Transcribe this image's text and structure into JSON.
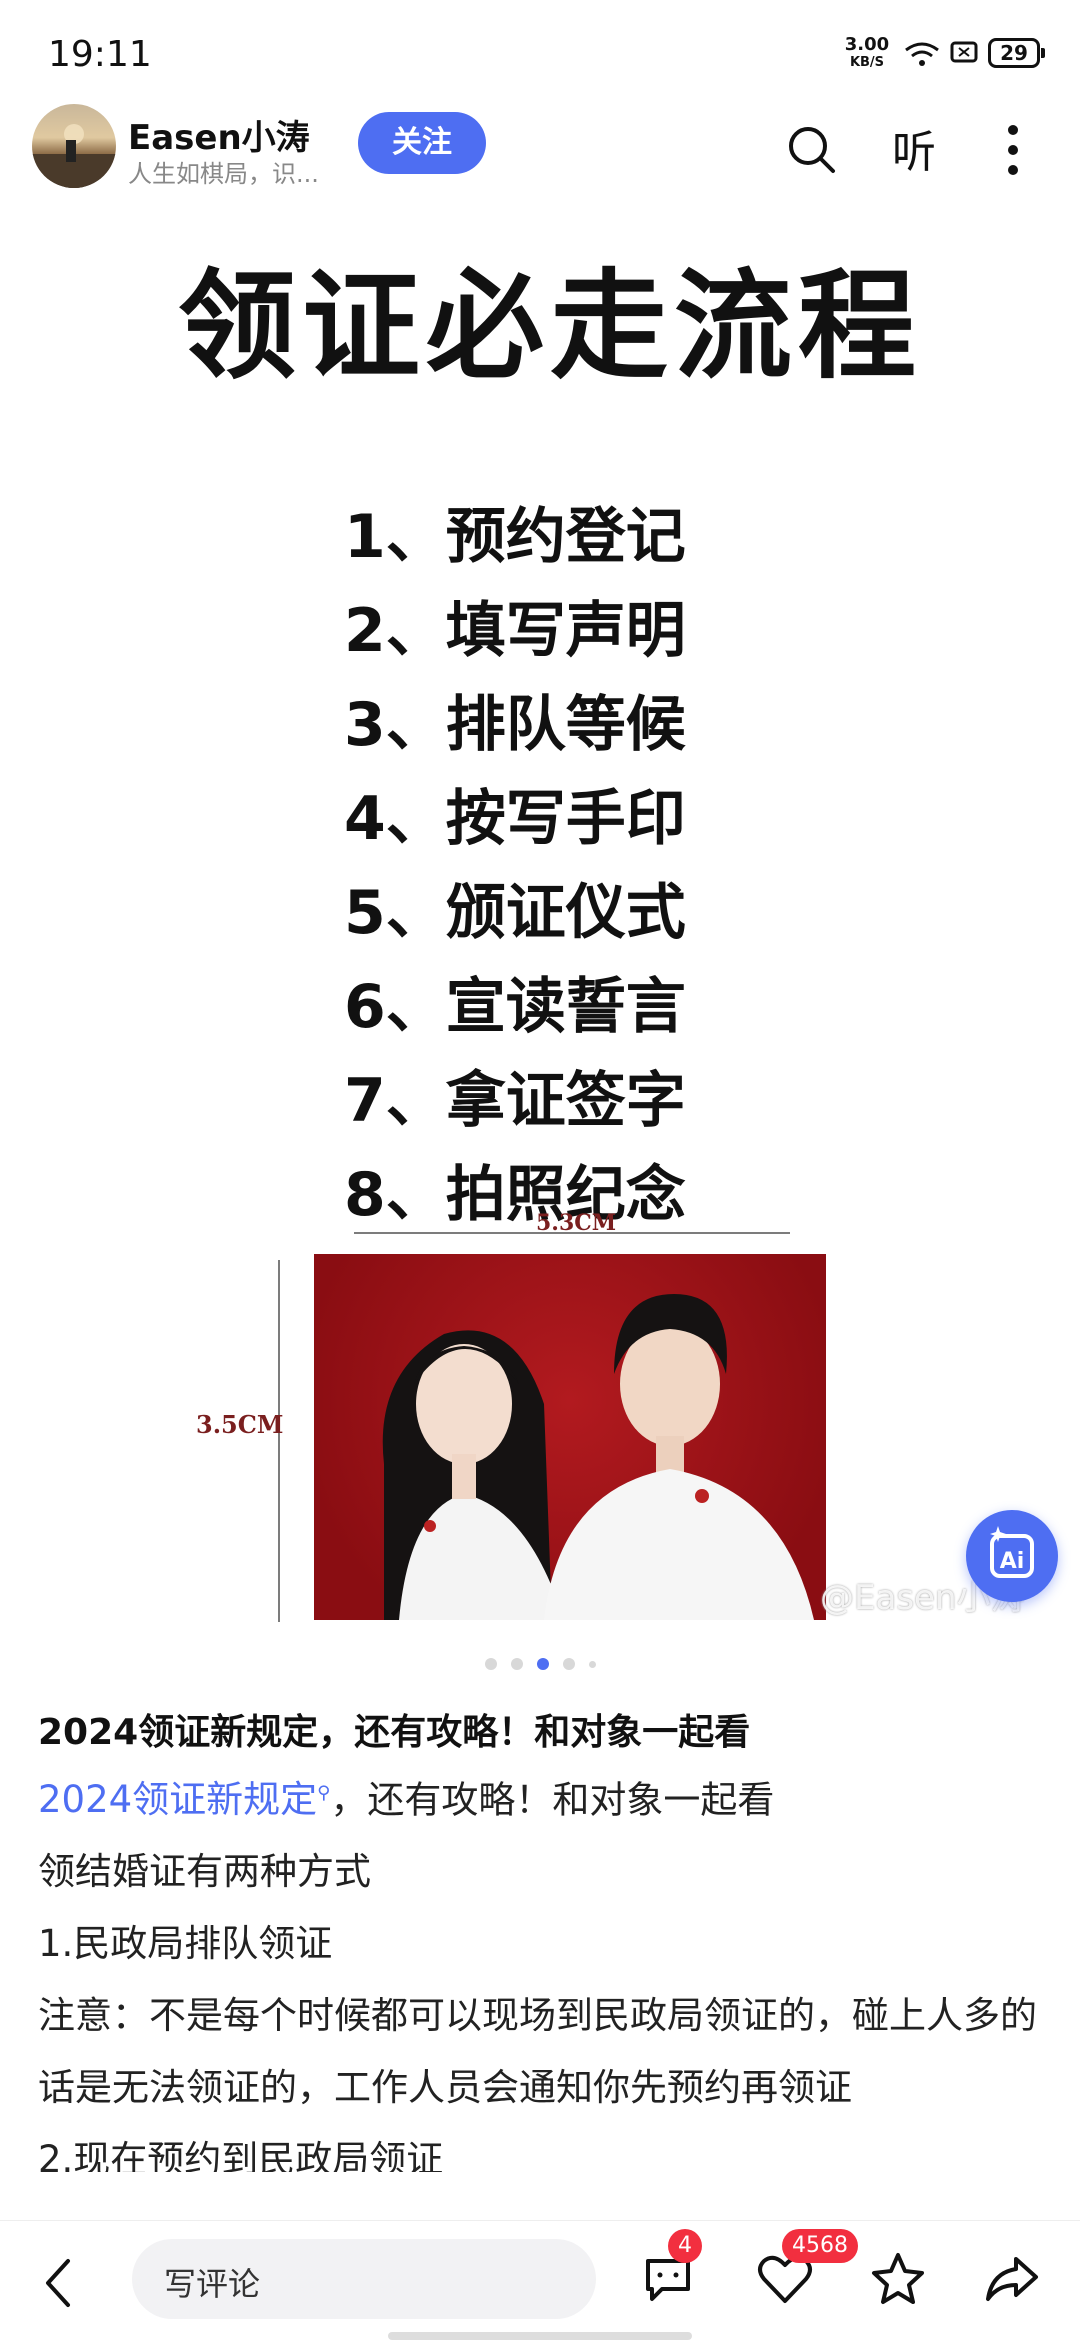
{
  "status_bar": {
    "time": "19:11",
    "net_speed": "3.00",
    "net_unit": "KB/S",
    "battery": "29"
  },
  "header": {
    "author_name": "Easen小涛",
    "author_bio": "人生如棋局，识...",
    "follow_label": "关注",
    "listen_label": "听"
  },
  "poster": {
    "title": "领证必走流程",
    "steps": [
      "1、预约登记",
      "2、填写声明",
      "3、排队等候",
      "4、按写手印",
      "5、颁证仪式",
      "6、宣读誓言",
      "7、拿证签字",
      "8、拍照纪念"
    ],
    "width_label": "5.3CM",
    "height_label": "3.5CM",
    "watermark": "@Easen小涛"
  },
  "carousel": {
    "count": 5,
    "active_index": 2
  },
  "article": {
    "title": "2024领证新规定，还有攻略！和对象一起看",
    "link_text": "2024领证新规定",
    "line1_rest": "，还有攻略！和对象一起看",
    "p2": "领结婚证有两种方式",
    "p3": "1.民政局排队领证",
    "p4": "注意：不是每个时候都可以现场到民政局领证的，碰上人多的话是无法领证的，工作人员会通知你先预约再领证",
    "p5": "2.现在预约到民政局领证"
  },
  "bottom_bar": {
    "comment_placeholder": "写评论",
    "comment_count": "4",
    "like_count": "4568"
  },
  "colors": {
    "accent": "#4e6ef2",
    "badge": "#f22f3f",
    "photo_bg": "#9a1218"
  }
}
